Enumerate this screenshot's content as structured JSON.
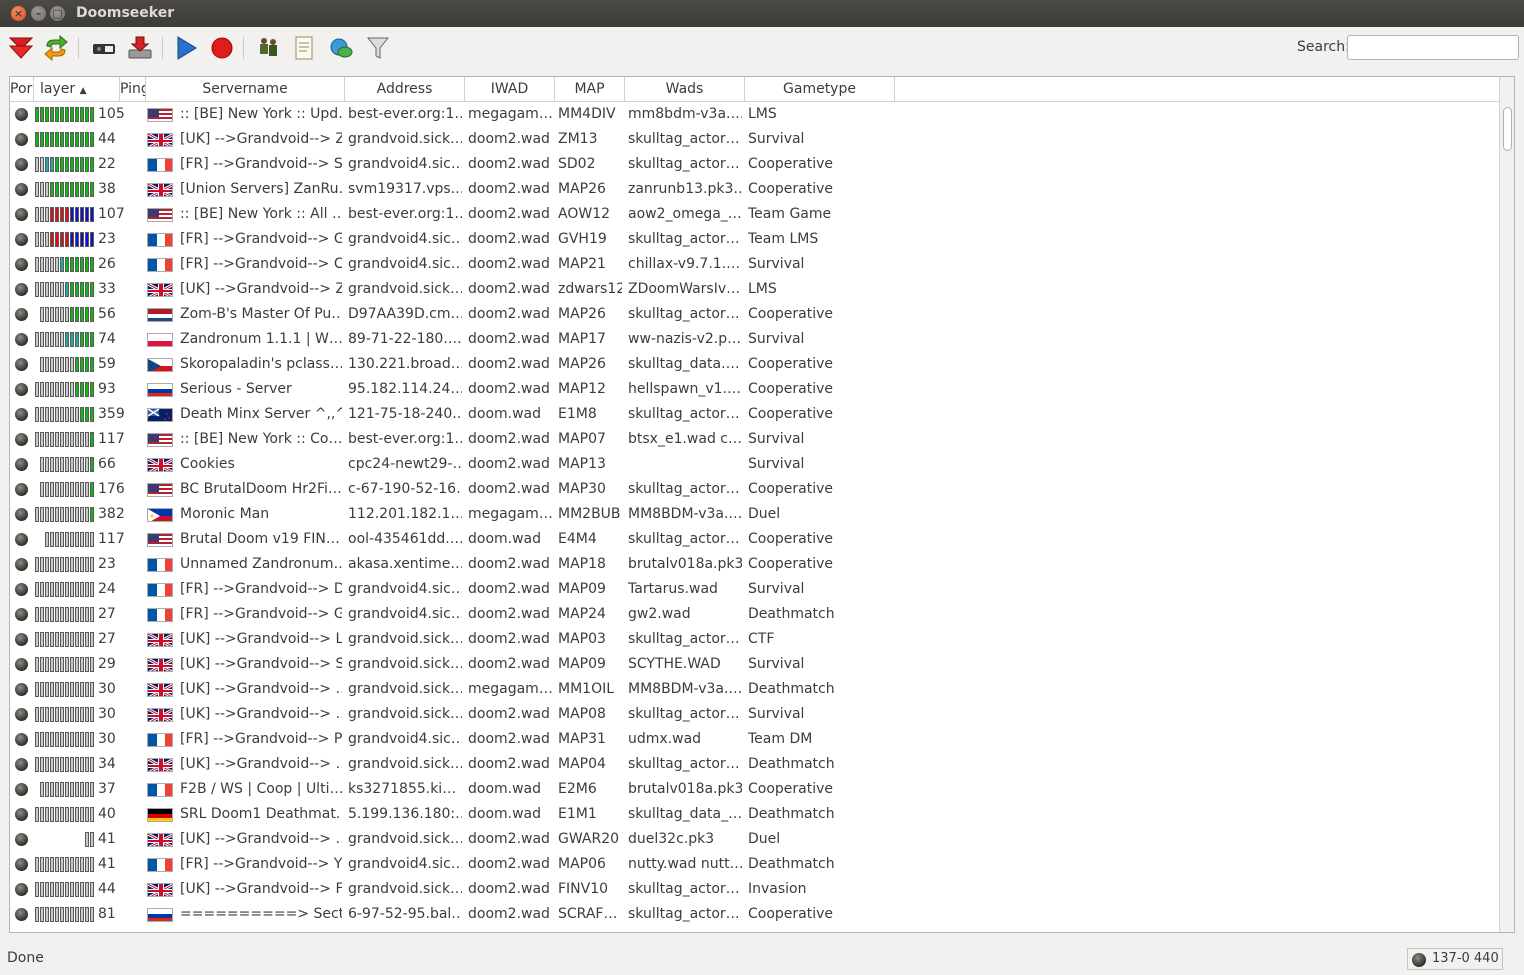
{
  "window": {
    "title": "Doomseeker"
  },
  "toolbar": {
    "search_label": "Search:",
    "search_value": "",
    "buttons": [
      "get-servers-icon",
      "refresh-icon",
      "connect-icon",
      "install-icon",
      "play-icon",
      "record-icon",
      "buddies-icon",
      "log-icon",
      "ircchat-icon",
      "filter-icon"
    ]
  },
  "columns": [
    "Por",
    "layer",
    "Ping",
    "Servername",
    "Address",
    "IWAD",
    "MAP",
    "Wads",
    "Gametype"
  ],
  "colors": {
    "player_green": "#11b811",
    "player_red": "#dd1111",
    "player_blue": "#1111cc",
    "player_teal": "#22aaaa",
    "bot_gray": "#c8c8c8"
  },
  "rows": [
    {
      "ping": "105",
      "flag": "us",
      "servername": ":: [BE] New York :: Upd…",
      "address": "best-ever.org:1…",
      "iwad": "megagam…",
      "map": "MM4DIV",
      "wads": "mm8bdm-v3a.…",
      "gametype": "LMS",
      "players": [
        "g",
        "g",
        "g",
        "g",
        "g",
        "g",
        "g",
        "g",
        "g",
        "g",
        "g",
        "g"
      ]
    },
    {
      "ping": "44",
      "flag": "uk",
      "servername": "[UK] -->Grandvoid--> Z…",
      "address": "grandvoid.sick…",
      "iwad": "doom2.wad",
      "map": "ZM13",
      "wads": "skulltag_actor…",
      "gametype": "Survival",
      "players": [
        "g",
        "g",
        "g",
        "g",
        "g",
        "g",
        "g",
        "g",
        "g",
        "g",
        "g",
        "g"
      ]
    },
    {
      "ping": "22",
      "flag": "fr",
      "servername": "[FR] -->Grandvoid--> S…",
      "address": "grandvoid4.sic…",
      "iwad": "doom2.wad",
      "map": "SD02",
      "wads": "skulltag_actor…",
      "gametype": "Cooperative",
      "players": [
        "s",
        "s",
        "t",
        "t",
        "g",
        "g",
        "g",
        "g",
        "g",
        "g",
        "g",
        "g"
      ]
    },
    {
      "ping": "38",
      "flag": "uk",
      "servername": "[Union Servers] ZanRu…",
      "address": "svm19317.vps.…",
      "iwad": "doom2.wad",
      "map": "MAP26",
      "wads": "zanrunb13.pk3…",
      "gametype": "Cooperative",
      "players": [
        "s",
        "s",
        "s",
        "g",
        "g",
        "g",
        "g",
        "g",
        "g",
        "g",
        "g",
        "g"
      ]
    },
    {
      "ping": "107",
      "flag": "us",
      "servername": ":: [BE] New York :: All …",
      "address": "best-ever.org:1…",
      "iwad": "doom2.wad",
      "map": "AOW12",
      "wads": "aow2_omega_…",
      "gametype": "Team Game",
      "players": [
        "s",
        "s",
        "s",
        "r",
        "r",
        "r",
        "r",
        "b",
        "b",
        "b",
        "b",
        "b"
      ]
    },
    {
      "ping": "23",
      "flag": "fr",
      "servername": "[FR] -->Grandvoid--> G…",
      "address": "grandvoid4.sic…",
      "iwad": "doom2.wad",
      "map": "GVH19",
      "wads": "skulltag_actor…",
      "gametype": "Team LMS",
      "players": [
        "s",
        "s",
        "s",
        "r",
        "r",
        "r",
        "r",
        "b",
        "b",
        "b",
        "b",
        "b"
      ]
    },
    {
      "ping": "26",
      "flag": "fr",
      "servername": "[FR] -->Grandvoid--> C…",
      "address": "grandvoid4.sic…",
      "iwad": "doom2.wad",
      "map": "MAP21",
      "wads": "chillax-v9.7.1.…",
      "gametype": "Survival",
      "players": [
        "s",
        "s",
        "s",
        "s",
        "s",
        "t",
        "g",
        "g",
        "g",
        "g",
        "g",
        "g"
      ]
    },
    {
      "ping": "33",
      "flag": "uk",
      "servername": "[UK] -->Grandvoid--> Z…",
      "address": "grandvoid.sick…",
      "iwad": "doom2.wad",
      "map": "zdwars12",
      "wads": "ZDoomWarsIv…",
      "gametype": "LMS",
      "players": [
        "s",
        "s",
        "s",
        "s",
        "s",
        "s",
        "t",
        "g",
        "g",
        "g",
        "g",
        "g"
      ]
    },
    {
      "ping": "56",
      "flag": "nl",
      "servername": "Zom-B's Master Of Pu…",
      "address": "D97AA39D.cm…",
      "iwad": "doom2.wad",
      "map": "MAP26",
      "wads": "skulltag_actor…",
      "gametype": "Cooperative",
      "players": [
        "s",
        "s",
        "s",
        "s",
        "s",
        "s",
        "g",
        "g",
        "g",
        "g",
        "g"
      ]
    },
    {
      "ping": "74",
      "flag": "pl",
      "servername": "Zandronum 1.1.1 | W…",
      "address": "89-71-22-180.…",
      "iwad": "doom2.wad",
      "map": "MAP17",
      "wads": "ww-nazis-v2.p…",
      "gametype": "Survival",
      "players": [
        "s",
        "s",
        "s",
        "s",
        "s",
        "s",
        "t",
        "t",
        "t",
        "g",
        "g",
        "g"
      ]
    },
    {
      "ping": "59",
      "flag": "cz",
      "servername": "Skoropaladin's pclass…",
      "address": "130.221.broad…",
      "iwad": "doom2.wad",
      "map": "MAP26",
      "wads": "skulltag_data.…",
      "gametype": "Cooperative",
      "players": [
        "s",
        "s",
        "s",
        "s",
        "s",
        "s",
        "s",
        "g",
        "g",
        "g",
        "g"
      ]
    },
    {
      "ping": "93",
      "flag": "ru",
      "servername": "Serious - Server",
      "address": "95.182.114.24…",
      "iwad": "doom2.wad",
      "map": "MAP12",
      "wads": "hellspawn_v1.…",
      "gametype": "Cooperative",
      "players": [
        "s",
        "s",
        "s",
        "s",
        "s",
        "s",
        "s",
        "s",
        "g",
        "g",
        "g",
        "g"
      ]
    },
    {
      "ping": "359",
      "flag": "nz",
      "servername": "Death Minx Server ^,,^",
      "address": "121-75-18-240.…",
      "iwad": "doom.wad",
      "map": "E1M8",
      "wads": "skulltag_actor…",
      "gametype": "Cooperative",
      "players": [
        "s",
        "s",
        "s",
        "s",
        "s",
        "s",
        "s",
        "s",
        "s",
        "g",
        "g",
        "g"
      ]
    },
    {
      "ping": "117",
      "flag": "us",
      "servername": ":: [BE] New York :: Co…",
      "address": "best-ever.org:1…",
      "iwad": "doom2.wad",
      "map": "MAP07",
      "wads": "btsx_e1.wad c…",
      "gametype": "Survival",
      "players": [
        "s",
        "s",
        "s",
        "s",
        "s",
        "s",
        "s",
        "s",
        "s",
        "s",
        "s",
        "g"
      ]
    },
    {
      "ping": "66",
      "flag": "uk",
      "servername": "Cookies",
      "address": "cpc24-newt29-…",
      "iwad": "doom2.wad",
      "map": "MAP13",
      "wads": "",
      "gametype": "Survival",
      "players": [
        "s",
        "s",
        "s",
        "s",
        "s",
        "s",
        "s",
        "s",
        "s",
        "s",
        "g"
      ]
    },
    {
      "ping": "176",
      "flag": "us",
      "servername": "BC BrutalDoom Hr2Fi…",
      "address": "c-67-190-52-16…",
      "iwad": "doom2.wad",
      "map": "MAP30",
      "wads": "skulltag_actor…",
      "gametype": "Cooperative",
      "players": [
        "s",
        "s",
        "s",
        "s",
        "s",
        "s",
        "s",
        "s",
        "s",
        "s",
        "g"
      ]
    },
    {
      "ping": "382",
      "flag": "ph",
      "servername": "Moronic Man",
      "address": "112.201.182.1…",
      "iwad": "megagam…",
      "map": "MM2BUB",
      "wads": "MM8BDM-v3a.…",
      "gametype": "Duel",
      "players": [
        "s",
        "s",
        "s",
        "s",
        "s",
        "s",
        "s",
        "s",
        "s",
        "s",
        "s",
        "g"
      ]
    },
    {
      "ping": "117",
      "flag": "us",
      "servername": "Brutal Doom v19 FIN…",
      "address": "ool-435461dd.…",
      "iwad": "doom.wad",
      "map": "E4M4",
      "wads": "skulltag_actor…",
      "gametype": "Cooperative",
      "players": [
        "s",
        "s",
        "s",
        "s",
        "s",
        "s",
        "s",
        "s",
        "s",
        "s"
      ]
    },
    {
      "ping": "23",
      "flag": "fr",
      "servername": "Unnamed Zandronum…",
      "address": "akasa.xentime…",
      "iwad": "doom2.wad",
      "map": "MAP18",
      "wads": "brutalv018a.pk3",
      "gametype": "Cooperative",
      "players": [
        "s",
        "s",
        "s",
        "s",
        "s",
        "s",
        "s",
        "s",
        "s",
        "s",
        "s",
        "s"
      ]
    },
    {
      "ping": "24",
      "flag": "fr",
      "servername": "[FR] -->Grandvoid--> D…",
      "address": "grandvoid4.sic…",
      "iwad": "doom2.wad",
      "map": "MAP09",
      "wads": "Tartarus.wad",
      "gametype": "Survival",
      "players": [
        "s",
        "s",
        "s",
        "s",
        "s",
        "s",
        "s",
        "s",
        "s",
        "s",
        "s",
        "s"
      ]
    },
    {
      "ping": "27",
      "flag": "fr",
      "servername": "[FR] -->Grandvoid--> G…",
      "address": "grandvoid4.sic…",
      "iwad": "doom2.wad",
      "map": "MAP24",
      "wads": "gw2.wad",
      "gametype": "Deathmatch",
      "players": [
        "s",
        "s",
        "s",
        "s",
        "s",
        "s",
        "s",
        "s",
        "s",
        "s",
        "s",
        "s"
      ]
    },
    {
      "ping": "27",
      "flag": "uk",
      "servername": "[UK] -->Grandvoid--> L…",
      "address": "grandvoid.sick…",
      "iwad": "doom2.wad",
      "map": "MAP03",
      "wads": "skulltag_actor…",
      "gametype": "CTF",
      "players": [
        "s",
        "s",
        "s",
        "s",
        "s",
        "s",
        "s",
        "s",
        "s",
        "s",
        "s",
        "s"
      ]
    },
    {
      "ping": "29",
      "flag": "uk",
      "servername": "[UK] -->Grandvoid--> S…",
      "address": "grandvoid.sick…",
      "iwad": "doom2.wad",
      "map": "MAP09",
      "wads": "SCYTHE.WAD",
      "gametype": "Survival",
      "players": [
        "s",
        "s",
        "s",
        "s",
        "s",
        "s",
        "s",
        "s",
        "s",
        "s",
        "s",
        "s"
      ]
    },
    {
      "ping": "30",
      "flag": "uk",
      "servername": "[UK] -->Grandvoid--> …",
      "address": "grandvoid.sick…",
      "iwad": "megagam…",
      "map": "MM1OIL",
      "wads": "MM8BDM-v3a.…",
      "gametype": "Deathmatch",
      "players": [
        "s",
        "s",
        "s",
        "s",
        "s",
        "s",
        "s",
        "s",
        "s",
        "s",
        "s",
        "s"
      ]
    },
    {
      "ping": "30",
      "flag": "uk",
      "servername": "[UK] -->Grandvoid--> …",
      "address": "grandvoid.sick…",
      "iwad": "doom2.wad",
      "map": "MAP08",
      "wads": "skulltag_actor…",
      "gametype": "Survival",
      "players": [
        "s",
        "s",
        "s",
        "s",
        "s",
        "s",
        "s",
        "s",
        "s",
        "s",
        "s",
        "s"
      ]
    },
    {
      "ping": "30",
      "flag": "fr",
      "servername": "[FR] -->Grandvoid--> P…",
      "address": "grandvoid4.sic…",
      "iwad": "doom2.wad",
      "map": "MAP31",
      "wads": "udmx.wad",
      "gametype": "Team DM",
      "players": [
        "s",
        "s",
        "s",
        "s",
        "s",
        "s",
        "s",
        "s",
        "s",
        "s",
        "s",
        "s"
      ]
    },
    {
      "ping": "34",
      "flag": "uk",
      "servername": "[UK] -->Grandvoid--> …",
      "address": "grandvoid.sick…",
      "iwad": "doom2.wad",
      "map": "MAP04",
      "wads": "skulltag_actor…",
      "gametype": "Deathmatch",
      "players": [
        "s",
        "s",
        "s",
        "s",
        "s",
        "s",
        "s",
        "s",
        "s",
        "s",
        "s",
        "s"
      ]
    },
    {
      "ping": "37",
      "flag": "fr",
      "servername": "F2B / WS | Coop | Ulti…",
      "address": "ks3271855.ki…",
      "iwad": "doom.wad",
      "map": "E2M6",
      "wads": "brutalv018a.pk3",
      "gametype": "Cooperative",
      "players": [
        "s",
        "s",
        "s",
        "s",
        "s",
        "s",
        "s",
        "s",
        "s",
        "s",
        "s"
      ]
    },
    {
      "ping": "40",
      "flag": "de",
      "servername": "SRL Doom1 Deathmat…",
      "address": "5.199.136.180:…",
      "iwad": "doom.wad",
      "map": "E1M1",
      "wads": "skulltag_data_…",
      "gametype": "Deathmatch",
      "players": [
        "s",
        "s",
        "s",
        "s",
        "s",
        "s",
        "s",
        "s",
        "s",
        "s",
        "s",
        "s"
      ]
    },
    {
      "ping": "41",
      "flag": "uk",
      "servername": "[UK] -->Grandvoid--> …",
      "address": "grandvoid.sick…",
      "iwad": "doom2.wad",
      "map": "GWAR20",
      "wads": "duel32c.pk3",
      "gametype": "Duel",
      "players": [
        "s",
        "s"
      ]
    },
    {
      "ping": "41",
      "flag": "fr",
      "servername": "[FR] -->Grandvoid--> Y…",
      "address": "grandvoid4.sic…",
      "iwad": "doom2.wad",
      "map": "MAP06",
      "wads": "nutty.wad nutt…",
      "gametype": "Deathmatch",
      "players": [
        "s",
        "s",
        "s",
        "s",
        "s",
        "s",
        "s",
        "s",
        "s",
        "s",
        "s",
        "s"
      ]
    },
    {
      "ping": "44",
      "flag": "uk",
      "servername": "[UK] -->Grandvoid--> F…",
      "address": "grandvoid.sick…",
      "iwad": "doom2.wad",
      "map": "FINV10",
      "wads": "skulltag_actor…",
      "gametype": "Invasion",
      "players": [
        "s",
        "s",
        "s",
        "s",
        "s",
        "s",
        "s",
        "s",
        "s",
        "s",
        "s",
        "s"
      ]
    },
    {
      "ping": "81",
      "flag": "ru",
      "servername": "==========> Sectorc…",
      "address": "6-97-52-95.bal…",
      "iwad": "doom2.wad",
      "map": "SCRAF…",
      "wads": "skulltag_actor…",
      "gametype": "Cooperative",
      "players": [
        "s",
        "s",
        "s",
        "s",
        "s",
        "s",
        "s",
        "s",
        "s",
        "s",
        "s",
        "s"
      ]
    }
  ],
  "status": {
    "text": "Done",
    "counts": "137-0 440"
  }
}
